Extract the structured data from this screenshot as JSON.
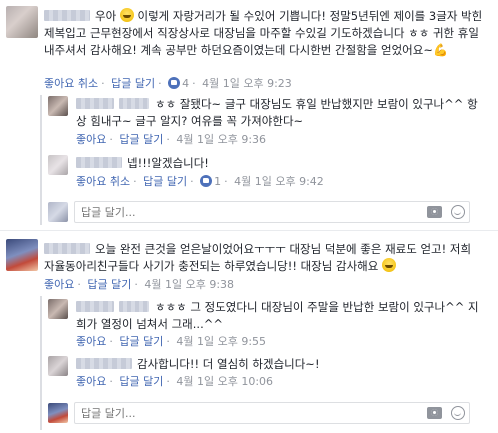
{
  "actions": {
    "like": "좋아요",
    "cancel": "취소",
    "reply": "답글 달기",
    "reply_placeholder": "답글 달기..."
  },
  "comments": [
    {
      "text": "우아",
      "text2": " 이렇게 자랑거리가 될 수있어 기쁩니다! 정말5년뒤엔 제이를 3글자 박힌 제복입고 근무현장에서 직장상사로 대장님을 마주할 수있길 기도하겠습니다 ㅎㅎ 귀한 휴일 내주셔서 감사해요! 계속 공부만 하던요즘이였는데 다시한번 간절함을 얻었어요~",
      "likes": "4",
      "time": "4월 1일 오후 9:23",
      "replies": [
        {
          "text": "ㅎㅎ 잘됐다~ 글구 대장님도 휴일 반납했지만 보람이 있구나^^ 항상 힘내구~ 글구 알지? 여유를 꼭 가져야한다~",
          "time": "4월 1일 오후 9:36"
        },
        {
          "text": "넵!!!알겠습니다!",
          "likes": "1",
          "time": "4월 1일 오후 9:42"
        }
      ]
    },
    {
      "text": "오늘 완전 큰것을 얻은날이었어요ㅜㅜㅜ 대장님 덕분에 좋은 재료도 얻고! 저희 자율동아리친구들다 사기가 충전되는 하루였습니당!! 대장님 감사해요",
      "time": "4월 1일 오후 9:38",
      "replies": [
        {
          "text": "ㅎㅎㅎ 그 정도였다니 대장님이 주말을 반납한 보람이 있구나^^ 지희가 열정이 넘쳐서 그래...^^",
          "time": "4월 1일 오후 9:55"
        },
        {
          "text": "감사합니다!! 더 열심히 하겠습니다~!",
          "time": "4월 1일 오후 10:06"
        }
      ]
    }
  ]
}
